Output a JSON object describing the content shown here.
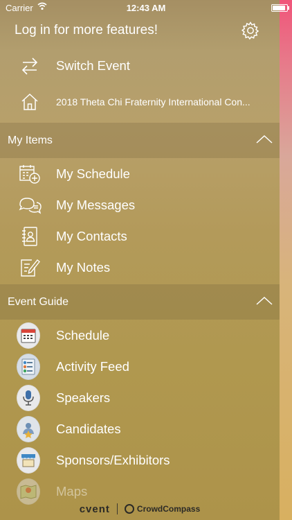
{
  "status": {
    "carrier": "Carrier",
    "time": "12:43 AM"
  },
  "header": {
    "login_text": "Log in for more features!"
  },
  "top": {
    "switch_event": "Switch Event",
    "current_event": "2018 Theta Chi Fraternity International Con..."
  },
  "my_items": {
    "title": "My Items",
    "items": [
      {
        "label": "My Schedule",
        "icon": "calendar-add-icon"
      },
      {
        "label": "My Messages",
        "icon": "chat-bubbles-icon"
      },
      {
        "label": "My Contacts",
        "icon": "address-book-icon"
      },
      {
        "label": "My Notes",
        "icon": "notepad-pencil-icon"
      }
    ]
  },
  "event_guide": {
    "title": "Event Guide",
    "items": [
      {
        "label": "Schedule",
        "icon": "calendar-icon"
      },
      {
        "label": "Activity Feed",
        "icon": "activity-feed-icon"
      },
      {
        "label": "Speakers",
        "icon": "microphone-icon"
      },
      {
        "label": "Candidates",
        "icon": "candidate-badge-icon"
      },
      {
        "label": "Sponsors/Exhibitors",
        "icon": "booth-icon"
      },
      {
        "label": "Maps",
        "icon": "map-icon"
      }
    ]
  },
  "footer": {
    "brand1": "cvent",
    "brand2": "CrowdCompass"
  },
  "colors": {
    "panel": "#b39a5c",
    "peek_top": "#f0557a",
    "text": "#ffffff"
  }
}
